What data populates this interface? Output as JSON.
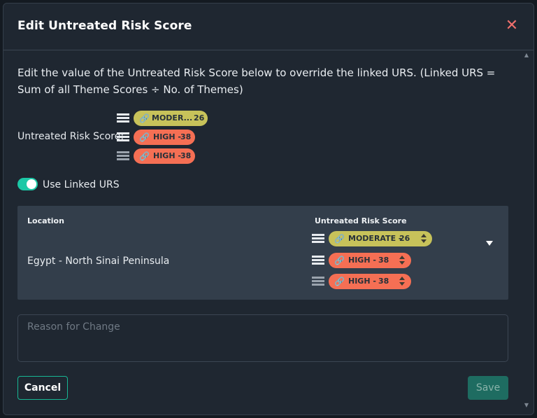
{
  "modal": {
    "title": "Edit Untreated Risk Score",
    "close_icon": "close-icon",
    "description": "Edit the value of the Untreated Risk Score below to override the linked URS. (Linked URS = Sum of all Theme Scores ÷ No. of Themes)"
  },
  "urs": {
    "label": "Untreated Risk Score:",
    "chips": [
      {
        "level": "MODER...",
        "score": "26",
        "color": "#c7c25a"
      },
      {
        "level": "HIGH -",
        "score": "38",
        "color": "#f56f54"
      },
      {
        "level": "HIGH -",
        "score": "38",
        "color": "#f56f54"
      }
    ]
  },
  "toggle": {
    "label": "Use Linked URS",
    "on": true,
    "color": "#1bc8a6"
  },
  "table": {
    "headers": {
      "location": "Location",
      "score": "Untreated Risk Score"
    },
    "row": {
      "location": "Egypt - North Sinai Peninsula",
      "chips": [
        {
          "level": "MODERATE -",
          "score": "26",
          "color": "#c7c25a"
        },
        {
          "level": "HIGH -",
          "score": "38",
          "color": "#f56f54"
        },
        {
          "level": "HIGH -",
          "score": "38",
          "color": "#f56f54"
        }
      ]
    }
  },
  "reason": {
    "placeholder": "Reason for Change",
    "value": ""
  },
  "buttons": {
    "cancel": "Cancel",
    "save": "Save"
  },
  "colors": {
    "accent": "#18b794",
    "moderate": "#c7c25a",
    "high": "#f56f54",
    "close": "#ef6f6c"
  }
}
